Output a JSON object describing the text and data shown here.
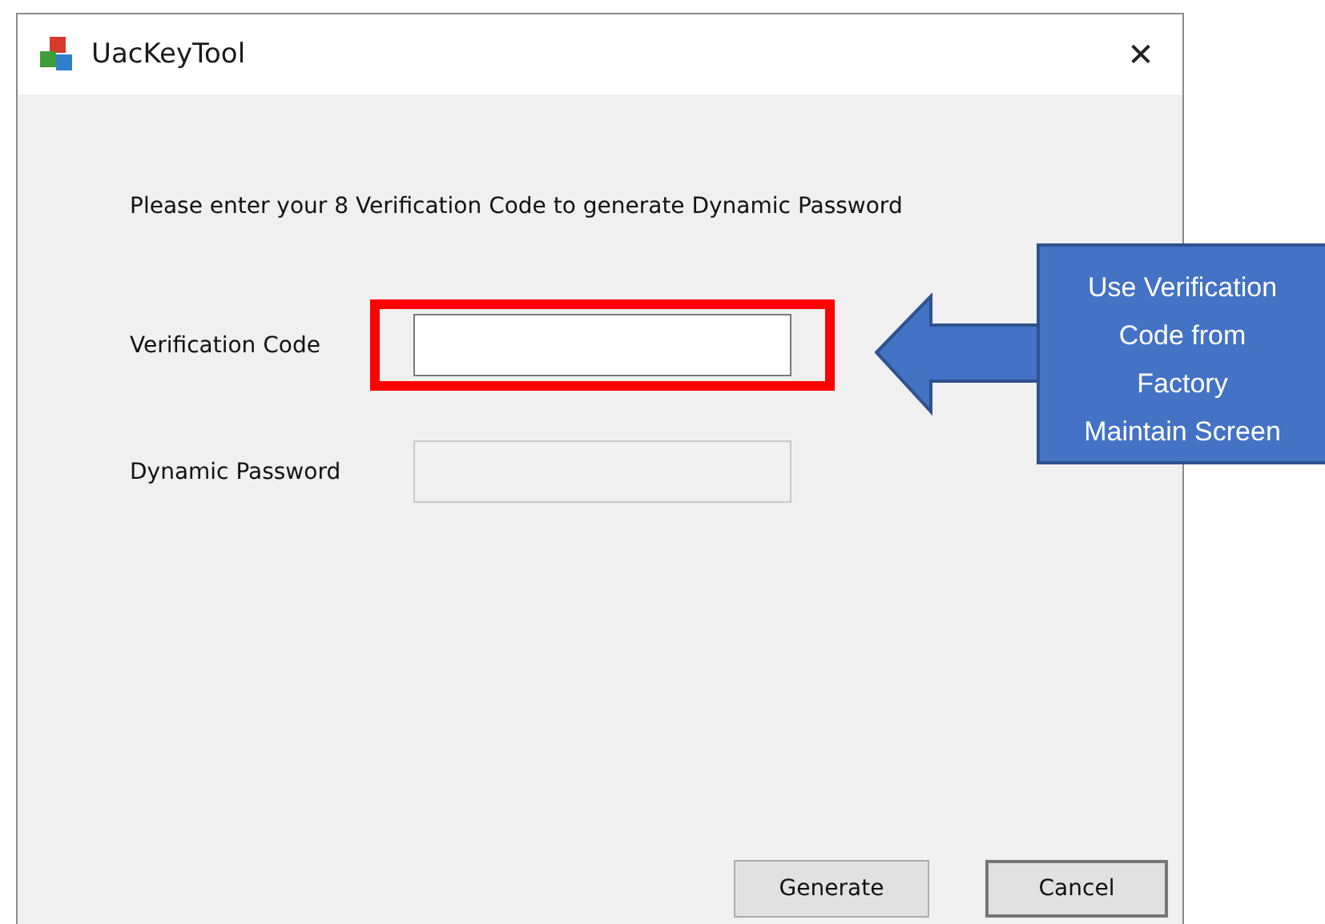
{
  "window": {
    "title": "UacKeyTool",
    "close": "✕"
  },
  "instruction": "Please enter your 8 Verification Code to generate Dynamic Password",
  "fields": [
    {
      "label": "Verification Code",
      "disabled": false,
      "highlighted": true
    },
    {
      "label": "Dynamic Password",
      "disabled": true,
      "highlighted": false
    }
  ],
  "buttons": [
    {
      "label": "Generate",
      "default": false
    },
    {
      "label": "Cancel",
      "default": true
    }
  ],
  "callout": {
    "lines": [
      "Use Verification",
      "Code from",
      "Factory",
      "Maintain Screen"
    ]
  }
}
